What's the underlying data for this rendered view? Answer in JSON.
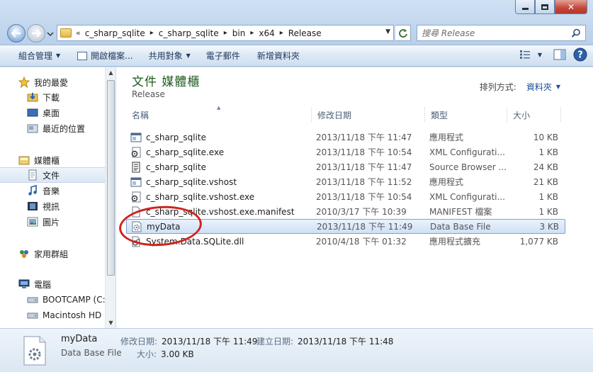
{
  "window": {
    "controls": {
      "minimize": "—",
      "maximize": "□",
      "close": "✕"
    }
  },
  "navigation": {
    "back_icon": "back-arrow-icon",
    "forward_icon": "forward-arrow-icon",
    "address": {
      "overflow": "«",
      "crumbs": [
        "c_sharp_sqlite",
        "c_sharp_sqlite",
        "bin",
        "x64",
        "Release"
      ]
    },
    "search_placeholder": "搜尋 Release"
  },
  "commandbar": {
    "organize": "組合管理",
    "open_file": "開啟檔案...",
    "share": "共用對象",
    "email": "電子郵件",
    "new_folder": "新增資料夾"
  },
  "navpane": {
    "favorites": "我的最愛",
    "downloads": "下載",
    "desktop": "桌面",
    "recent": "最近的位置",
    "libraries": "媒體櫃",
    "documents": "文件",
    "music": "音樂",
    "videos": "視訊",
    "pictures": "圖片",
    "homegroup": "家用群組",
    "computer": "電腦",
    "bootcamp": "BOOTCAMP (C:)",
    "macintosh": "Macintosh HD (I"
  },
  "library": {
    "title": "文件 媒體櫃",
    "subtitle": "Release",
    "arrange_label": "排列方式:",
    "arrange_value": "資料夾"
  },
  "columns": {
    "name": "名稱",
    "date": "修改日期",
    "type": "類型",
    "size": "大小"
  },
  "files": [
    {
      "name": "c_sharp_sqlite",
      "date": "2013/11/18 下午 11:47",
      "type": "應用程式",
      "size": "10 KB",
      "icon": "app-icon"
    },
    {
      "name": "c_sharp_sqlite.exe",
      "date": "2013/11/18 下午 10:54",
      "type": "XML Configurati...",
      "size": "1 KB",
      "icon": "config-icon"
    },
    {
      "name": "c_sharp_sqlite",
      "date": "2013/11/18 下午 11:47",
      "type": "Source Browser ...",
      "size": "24 KB",
      "icon": "document-icon"
    },
    {
      "name": "c_sharp_sqlite.vshost",
      "date": "2013/11/18 下午 11:52",
      "type": "應用程式",
      "size": "21 KB",
      "icon": "app-icon"
    },
    {
      "name": "c_sharp_sqlite.vshost.exe",
      "date": "2013/11/18 下午 10:54",
      "type": "XML Configurati...",
      "size": "1 KB",
      "icon": "config-icon"
    },
    {
      "name": "c_sharp_sqlite.vshost.exe.manifest",
      "date": "2010/3/17 下午 10:39",
      "type": "MANIFEST 檔案",
      "size": "1 KB",
      "icon": "blank-file-icon"
    },
    {
      "name": "myData",
      "date": "2013/11/18 下午 11:49",
      "type": "Data Base File",
      "size": "3 KB",
      "icon": "database-file-icon"
    },
    {
      "name": "System.Data.SQLite.dll",
      "date": "2010/4/18 下午 01:32",
      "type": "應用程式擴充",
      "size": "1,077 KB",
      "icon": "dll-icon"
    }
  ],
  "details": {
    "name": "myData",
    "type": "Data Base File",
    "modified_label": "修改日期:",
    "modified_value": "2013/11/18 下午 11:49",
    "created_label": "建立日期:",
    "created_value": "2013/11/18 下午 11:48",
    "size_label": "大小:",
    "size_value": "3.00 KB"
  },
  "colors": {
    "selection_border": "#7da2ce",
    "annotation_circle": "#d0231e",
    "library_title": "#1f5a1f"
  }
}
